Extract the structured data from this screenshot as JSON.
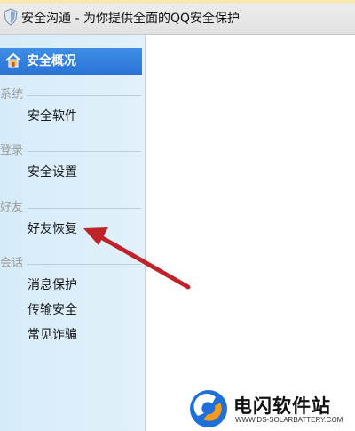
{
  "window": {
    "title": "安全沟通 - 为你提供全面的QQ安全保护",
    "title_icon": "shield-icon"
  },
  "sidebar": {
    "overview": {
      "label": "安全概况",
      "icon": "home-icon"
    },
    "sections": [
      {
        "title": "系统",
        "items": [
          "安全软件"
        ]
      },
      {
        "title": "登录",
        "items": [
          "安全设置"
        ]
      },
      {
        "title": "好友",
        "items": [
          "好友恢复"
        ]
      },
      {
        "title": "会话",
        "items": [
          "消息保护",
          "传输安全",
          "常见诈骗"
        ]
      }
    ]
  },
  "annotation": {
    "type": "red-arrow",
    "points_to": "好友恢复",
    "color": "#c0222a"
  },
  "watermark": {
    "brand": "电闪软件站",
    "site": "WWW.DS-SOLARBATTERY.COM",
    "colors": {
      "blue": "#1e6fd9",
      "orange": "#f39a1e"
    }
  }
}
